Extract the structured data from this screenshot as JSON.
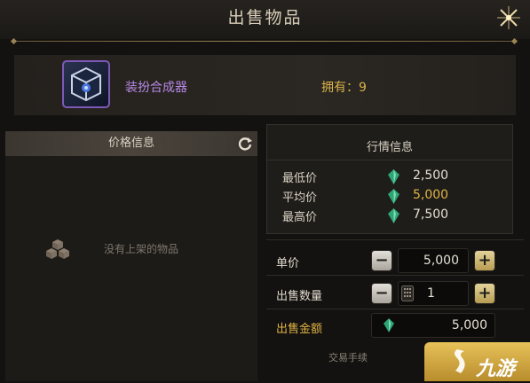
{
  "window": {
    "title": "出售物品"
  },
  "item": {
    "name": "装扮合成器",
    "owned": "拥有：9"
  },
  "price_panel": {
    "header": "价格信息",
    "empty_text": "没有上架的物品"
  },
  "market": {
    "title": "行情信息",
    "rows": [
      {
        "label": "最低价",
        "value": "2,500",
        "color": "#e6e0d4"
      },
      {
        "label": "平均价",
        "value": "5,000",
        "color": "#e0b544"
      },
      {
        "label": "最高价",
        "value": "7,500",
        "color": "#e6e0d4"
      }
    ]
  },
  "form": {
    "unit_price_label": "单价",
    "unit_price_value": "5,000",
    "quantity_label": "出售数量",
    "quantity_value": "1",
    "total_label": "出售金额",
    "total_value": "5,000",
    "fee_text": "交易手续"
  },
  "watermark": {
    "text": "九游"
  },
  "colors": {
    "accent_gold": "#e0b544",
    "item_purple": "#b889e6",
    "gem_green": "#3fc08a"
  },
  "icons": [
    "close-icon",
    "refresh-icon",
    "empty-box-icon",
    "gem-icon",
    "minus-icon",
    "plus-icon",
    "keypad-icon"
  ]
}
